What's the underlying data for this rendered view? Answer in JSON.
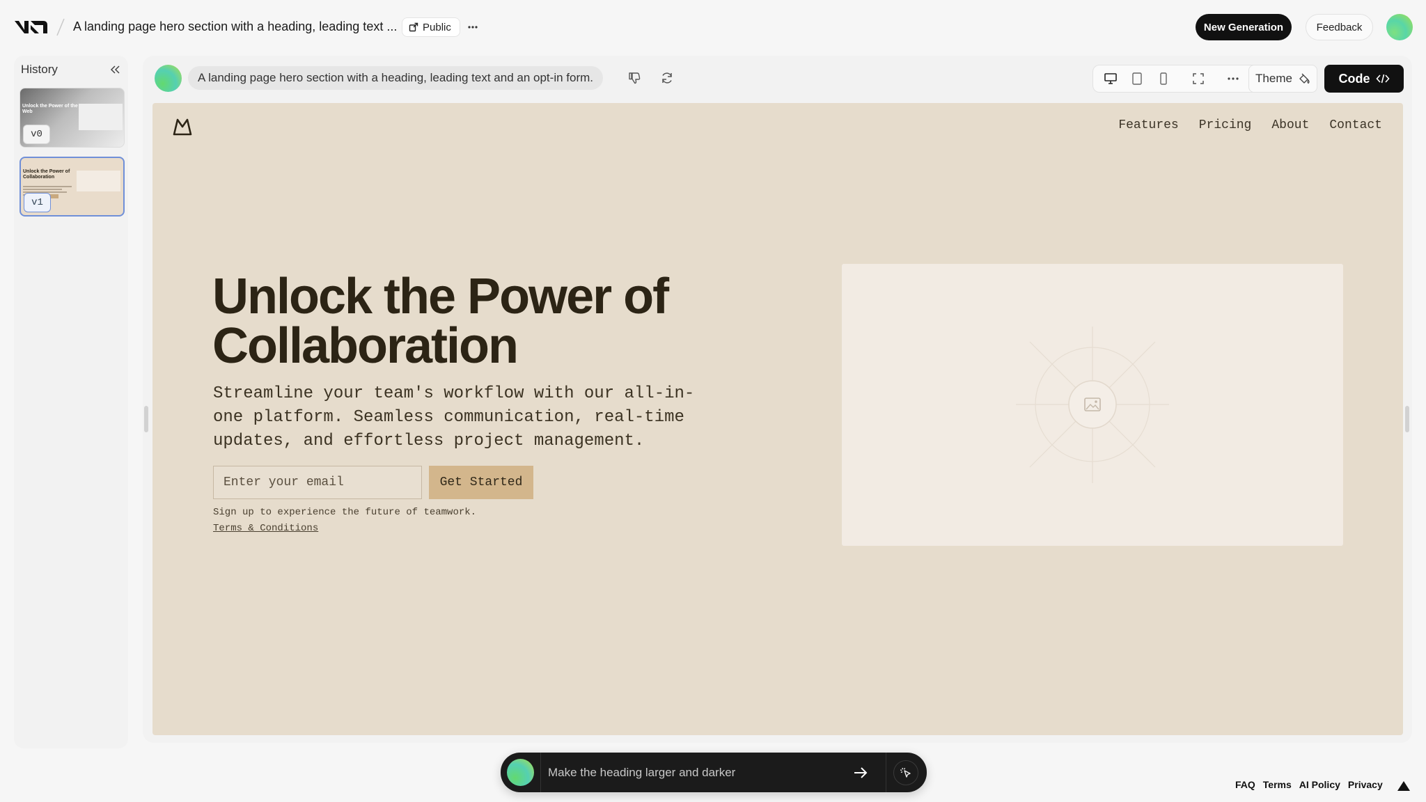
{
  "topbar": {
    "doc_title": "A landing page hero section with a heading, leading text ...",
    "public_label": "Public",
    "new_generation_label": "New Generation",
    "feedback_label": "Feedback"
  },
  "sidebar": {
    "title": "History",
    "versions": [
      {
        "label": "v0",
        "thumb_heading": "Unlock the Power of the Web"
      },
      {
        "label": "v1",
        "thumb_heading": "Unlock the Power of Collaboration"
      }
    ]
  },
  "panel": {
    "prompt": "A landing page hero section with a heading, leading text and an opt-in form.",
    "theme_label": "Theme",
    "code_label": "Code"
  },
  "site": {
    "nav": [
      "Features",
      "Pricing",
      "About",
      "Contact"
    ],
    "heading": "Unlock the Power of Collaboration",
    "subtext": "Streamline your team's workflow with our all-in-one platform. Seamless communication, real-time updates, and effortless project management.",
    "email_placeholder": "Enter your email",
    "cta_label": "Get Started",
    "signup_note": "Sign up to experience the future of teamwork.",
    "terms_label": "Terms & Conditions"
  },
  "chat": {
    "placeholder": "Make the heading larger and darker"
  },
  "footer": {
    "links": [
      "FAQ",
      "Terms",
      "AI Policy",
      "Privacy"
    ]
  },
  "colors": {
    "site_background": "#e6dccc",
    "heading_color": "#2c2415",
    "cta_background": "#d3b68c",
    "active_version_border": "#6f8fd8"
  }
}
